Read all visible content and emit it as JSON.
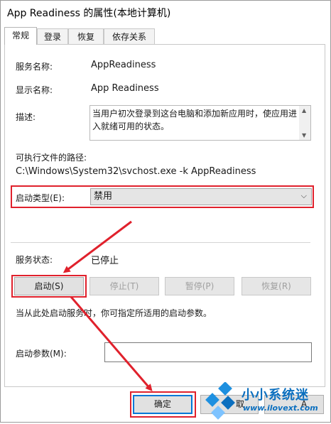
{
  "window": {
    "title": "App Readiness 的属性(本地计算机)"
  },
  "tabs": [
    {
      "label": "常规"
    },
    {
      "label": "登录"
    },
    {
      "label": "恢复"
    },
    {
      "label": "依存关系"
    }
  ],
  "general": {
    "service_name_label": "服务名称:",
    "service_name_value": "AppReadiness",
    "display_name_label": "显示名称:",
    "display_name_value": "App Readiness",
    "description_label": "描述:",
    "description_value": "当用户初次登录到这台电脑和添加新应用时，使应用进入就绪可用的状态。",
    "exe_path_label": "可执行文件的路径:",
    "exe_path_value": "C:\\Windows\\System32\\svchost.exe -k AppReadiness",
    "startup_type_label": "启动类型(E):",
    "startup_type_value": "禁用",
    "service_status_label": "服务状态:",
    "service_status_value": "已停止",
    "buttons": {
      "start": "启动(S)",
      "stop": "停止(T)",
      "pause": "暂停(P)",
      "resume": "恢复(R)"
    },
    "start_params_hint": "当从此处启动服务时，你可指定所适用的启动参数。",
    "start_params_label": "启动参数(M):",
    "start_params_value": ""
  },
  "footer": {
    "ok": "确定",
    "cancel_partial": "取",
    "apply_partial": "A"
  },
  "watermark": {
    "name": "小小系统迷",
    "url": "www.ilovext.com"
  },
  "colors": {
    "annotation_red": "#e0212c",
    "focus_blue": "#0078d7",
    "watermark_blue": "#0b6fbf"
  }
}
